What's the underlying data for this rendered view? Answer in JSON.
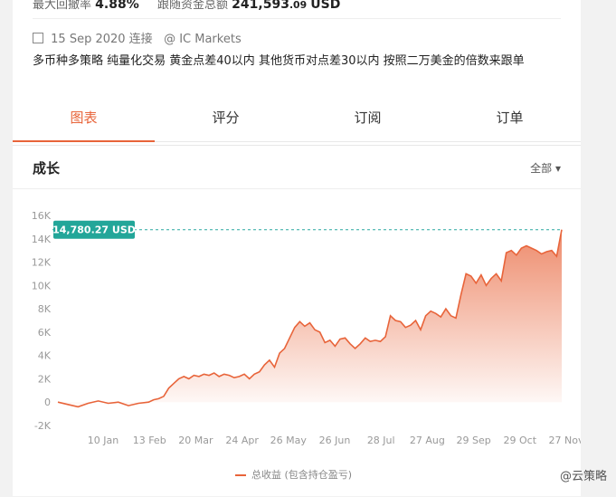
{
  "stats": {
    "drawdown_label": "最大回撤率",
    "drawdown_value": "4.88%",
    "funds_label": "跟随资金总额",
    "funds_value": "241,593",
    "funds_decimals": ".09",
    "funds_currency": "USD"
  },
  "meta": {
    "connected": "15 Sep 2020 连接",
    "broker": "@ IC Markets"
  },
  "description": "多币种多策略 纯量化交易 黄金点差40以内 其他货币对点差30以内 按照二万美金的倍数来跟单",
  "tabs": [
    {
      "label": "图表",
      "active": true
    },
    {
      "label": "评分",
      "active": false
    },
    {
      "label": "订阅",
      "active": false
    },
    {
      "label": "订单",
      "active": false
    }
  ],
  "growth": {
    "title": "成长",
    "filter": "全部"
  },
  "chart_data": {
    "type": "area",
    "y_ticks": [
      "16K",
      "14K",
      "12K",
      "10K",
      "8K",
      "6K",
      "4K",
      "2K",
      "0",
      "-2K"
    ],
    "ylim": [
      -2000,
      16000
    ],
    "x_ticks": [
      "10 Jan",
      "13 Feb",
      "20 Mar",
      "24 Apr",
      "26 May",
      "26 Jun",
      "28 Jul",
      "27 Aug",
      "29 Sep",
      "29 Oct",
      "27 Nov"
    ],
    "last_value_label": "14,780.27 USD",
    "last_value": 14780.27,
    "series": [
      {
        "name": "总收益 (包含持仓盈亏)",
        "color": "#e8643a",
        "x": [
          0,
          2,
          4,
          6,
          8,
          10,
          12,
          14,
          16,
          18,
          19,
          20,
          21,
          22,
          23,
          24,
          25,
          26,
          27,
          28,
          29,
          30,
          31,
          32,
          33,
          34,
          35,
          36,
          37,
          38,
          39,
          40,
          41,
          42,
          43,
          44,
          45,
          46,
          47,
          48,
          49,
          50,
          51,
          52,
          53,
          54,
          55,
          56,
          57,
          58,
          59,
          60,
          61,
          62,
          63,
          64,
          65,
          66,
          67,
          68,
          69,
          70,
          71,
          72,
          73,
          74,
          75,
          76,
          77,
          78,
          79,
          80,
          81,
          82,
          83,
          84,
          85,
          86,
          87,
          88,
          89,
          90,
          91,
          92,
          93,
          94,
          95,
          96,
          97,
          98,
          99,
          100
        ],
        "y": [
          0,
          -200,
          -400,
          -100,
          100,
          -100,
          0,
          -300,
          -100,
          0,
          200,
          300,
          500,
          1200,
          1600,
          2000,
          2200,
          2000,
          2300,
          2200,
          2400,
          2300,
          2500,
          2200,
          2400,
          2300,
          2100,
          2200,
          2400,
          2000,
          2400,
          2600,
          3200,
          3600,
          3000,
          4200,
          4600,
          5500,
          6400,
          6900,
          6500,
          6800,
          6200,
          6000,
          5100,
          5300,
          4800,
          5400,
          5500,
          5000,
          4600,
          5000,
          5500,
          5200,
          5300,
          5200,
          5600,
          7400,
          7000,
          6900,
          6400,
          6600,
          7000,
          6200,
          7400,
          7800,
          7600,
          7300,
          8000,
          7400,
          7200,
          9200,
          11000,
          10800,
          10200,
          10900,
          10000,
          10600,
          11000,
          10400,
          12800,
          13000,
          12600,
          13200,
          13400,
          13200,
          13000,
          12700,
          12900,
          13000,
          12500,
          14780.27
        ]
      }
    ],
    "grid": false,
    "legend": "bottom-center"
  },
  "watermark": "@云策略"
}
